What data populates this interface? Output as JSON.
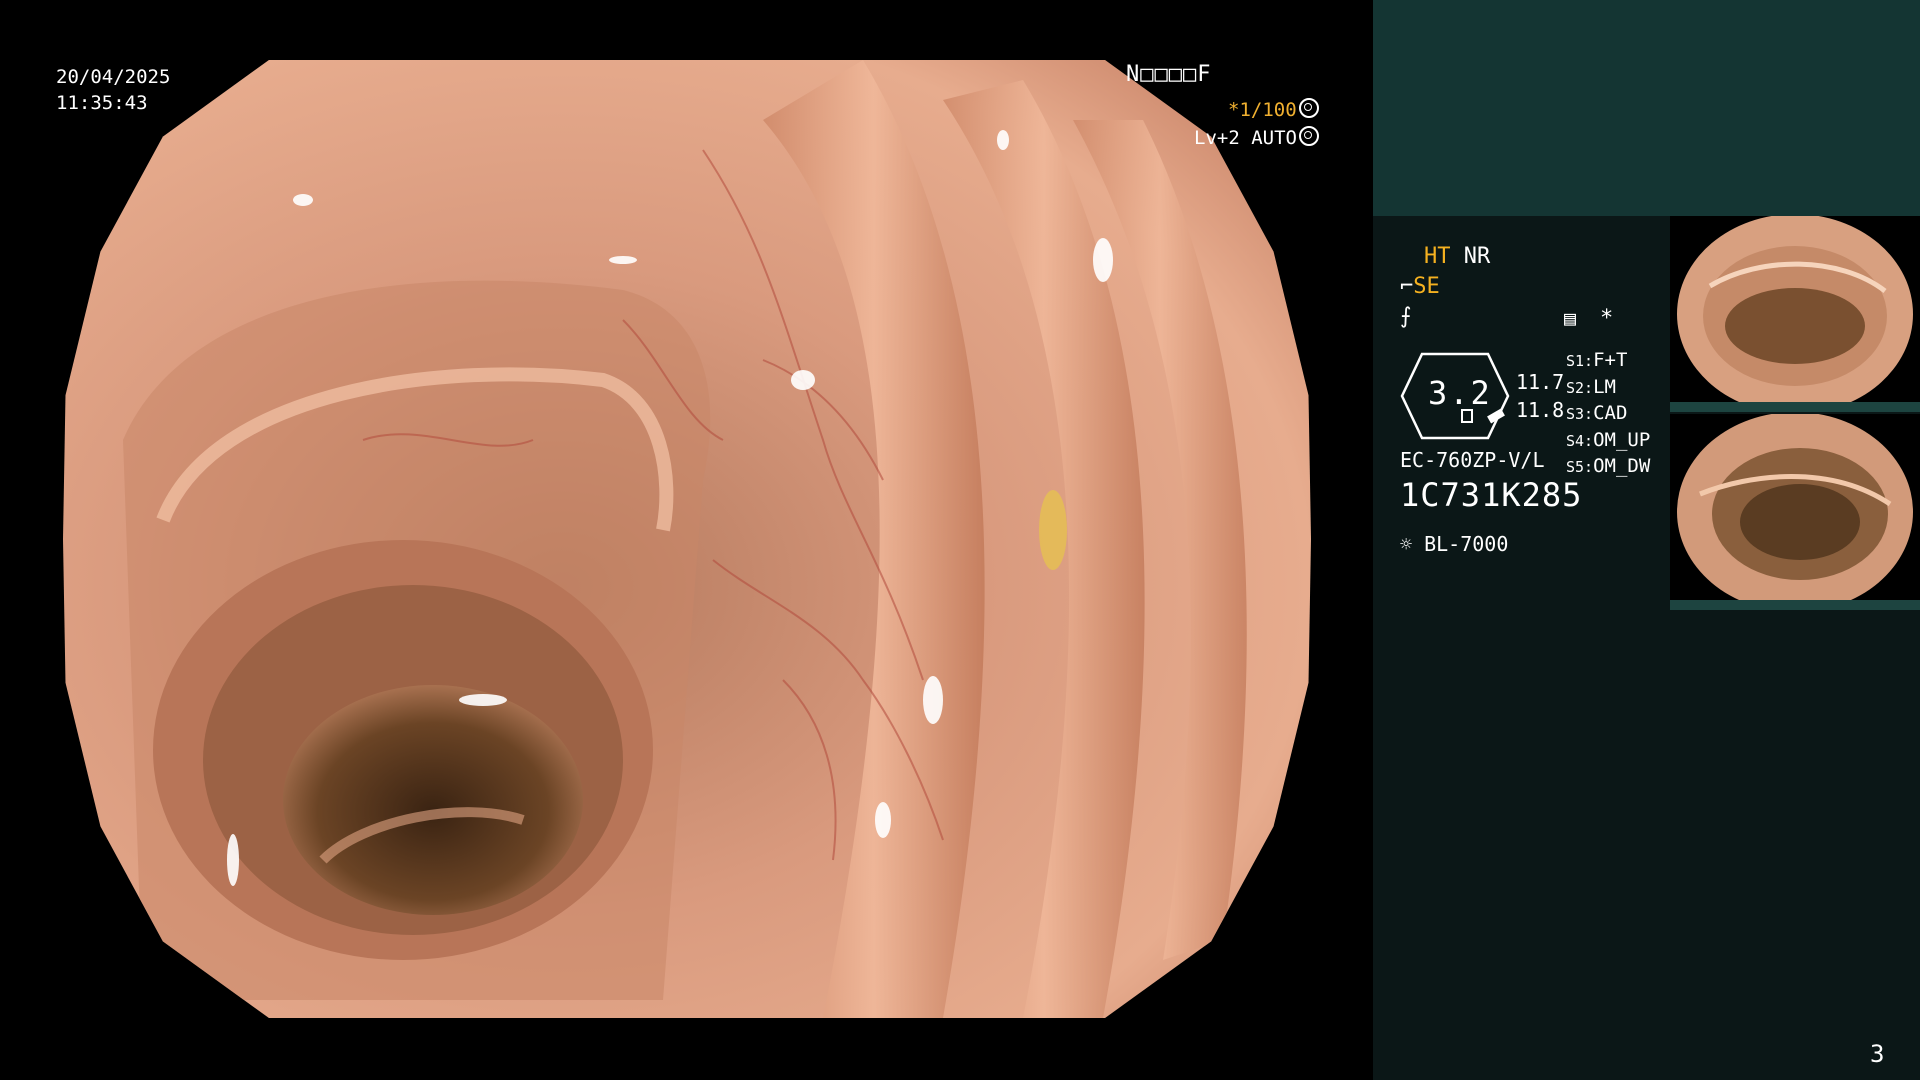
{
  "overlay": {
    "date": "20/04/2025",
    "time": "11:35:43",
    "patient_code": "N□□□□F",
    "zoom": "*1/100",
    "level": "Lv+2 AUTO"
  },
  "side": {
    "ht": "HT",
    "nr": "NR",
    "se": "SE",
    "s_items": [
      {
        "key": "S1:",
        "value": "F+T"
      },
      {
        "key": "S2:",
        "value": "LM"
      },
      {
        "key": "S3:",
        "value": "CAD"
      },
      {
        "key": "S4:",
        "value": "OM_UP"
      },
      {
        "key": "S5:",
        "value": "OM_DW"
      }
    ],
    "scope_value": "3.2",
    "val_top": "11.7",
    "val_bottom": "11.8",
    "scope_model": "EC-760ZP-V/L",
    "serial": "1C731K285",
    "light_source": "BL-7000",
    "asterisk": "*"
  },
  "page_number": "3",
  "colors": {
    "accent": "#f5b120",
    "panel_bg": "#0b1717",
    "panel_top": "#143533"
  }
}
